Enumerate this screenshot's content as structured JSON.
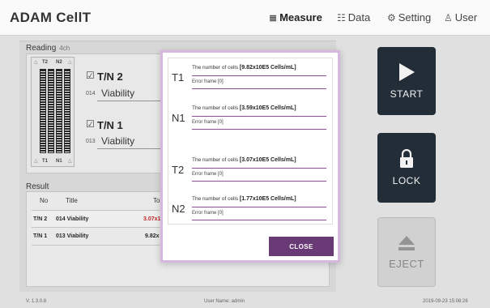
{
  "app": {
    "title": "ADAM CellT"
  },
  "nav": [
    {
      "label": "Measure",
      "icon": "≣",
      "active": true
    },
    {
      "label": "Data",
      "icon": "☷",
      "active": false
    },
    {
      "label": "Setting",
      "icon": "⚙",
      "active": false
    },
    {
      "label": "User",
      "icon": "♙",
      "active": false
    }
  ],
  "reading": {
    "title": "Reading",
    "channels": "4ch",
    "chip": {
      "top_left": "T2",
      "top_right": "N2",
      "bottom_left": "T1",
      "bottom_right": "N1",
      "triangle": "△"
    },
    "samples": [
      {
        "name": "T/N 2",
        "number": "014",
        "assay": "Viability",
        "checked": true
      },
      {
        "name": "T/N 1",
        "number": "013",
        "assay": "Viability",
        "checked": true
      }
    ]
  },
  "result": {
    "title": "Result",
    "columns": [
      "No",
      "Title",
      "Tot"
    ],
    "rows": [
      {
        "no": "T/N 2",
        "title": "014 Viability",
        "value": "3.07x1"
      },
      {
        "no": "T/N 1",
        "title": "013 Viability",
        "value": "9.82x"
      }
    ]
  },
  "buttons": {
    "start": "START",
    "lock": "LOCK",
    "eject": "EJECT"
  },
  "footer": {
    "version": "V. 1.3.0.8",
    "user": "User Name: admin",
    "datetime": "2019-09-23 15:08:26"
  },
  "modal": {
    "entries": [
      {
        "code": "T1",
        "label": "The number of cells",
        "value": "[9.82x10E5 Cells/mL]",
        "error": "Error frame [0]"
      },
      {
        "code": "N1",
        "label": "The number of cells",
        "value": "[3.59x10E5 Cells/mL]",
        "error": "Error frame [0]"
      },
      {
        "code": "T2",
        "label": "The number of cells",
        "value": "[3.07x10E5 Cells/mL]",
        "error": "Error frame [0]"
      },
      {
        "code": "N2",
        "label": "The number of cells",
        "value": "[1.77x10E5 Cells/mL]",
        "error": "Error frame [0]"
      }
    ],
    "close_label": "CLOSE"
  },
  "colors": {
    "accent": "#6a3a77",
    "start_button": "#1f2a36",
    "highlight_value": "#c82020"
  }
}
